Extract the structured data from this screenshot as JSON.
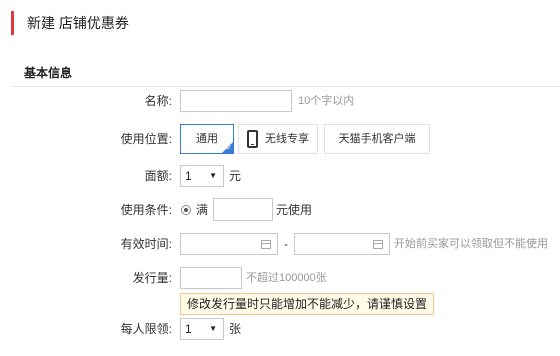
{
  "header": {
    "title": "新建 店铺优惠券"
  },
  "section": {
    "title": "基本信息"
  },
  "form": {
    "name": {
      "label": "名称:",
      "value": "",
      "hint": "10个字以内"
    },
    "position": {
      "label": "使用位置:",
      "options": [
        {
          "label": "通用",
          "selected": true
        },
        {
          "label": "无线专享",
          "selected": false,
          "icon": "phone-icon"
        },
        {
          "label": "天猫手机客户端",
          "selected": false
        }
      ]
    },
    "amount": {
      "label": "面额:",
      "value": "1",
      "unit": "元"
    },
    "condition": {
      "label": "使用条件:",
      "radio_label": "满",
      "value": "",
      "suffix": "元使用"
    },
    "valid_time": {
      "label": "有效时间:",
      "start": "",
      "separator": "-",
      "end": "",
      "hint": "开始前买家可以领取但不能使用",
      "icon": "calendar-icon"
    },
    "issue_qty": {
      "label": "发行量:",
      "value": "",
      "hint": "不超过100000张",
      "tip": "修改发行量时只能增加不能减少，请谨慎设置"
    },
    "limit": {
      "label": "每人限领:",
      "value": "1",
      "unit": "张"
    }
  },
  "colors": {
    "accent": "#e4393c",
    "selected_border": "#3a7bd5",
    "tip_bg": "#fffbe8",
    "tip_border": "#f0c98a"
  }
}
